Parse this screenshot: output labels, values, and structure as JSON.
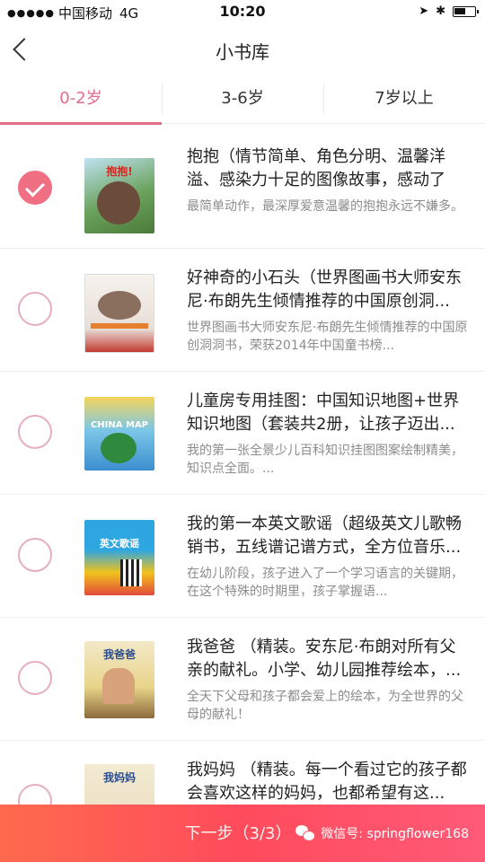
{
  "status_bar": {
    "carrier": "中国移动",
    "network": "4G",
    "time": "10:20"
  },
  "nav": {
    "title": "小书库"
  },
  "tabs": [
    {
      "label": "0-2岁",
      "active": true
    },
    {
      "label": "3-6岁",
      "active": false
    },
    {
      "label": "7岁以上",
      "active": false
    }
  ],
  "books": [
    {
      "title": "抱抱（情节简单、角色分明、温馨洋溢、感染力十足的图像故事，感动了无...",
      "desc": "最简单动作，最深厚爱意温馨的抱抱永远不嫌多。",
      "checked": true,
      "cover_text": "抱抱!"
    },
    {
      "title": "好神奇的小石头（世界图画书大师安东尼·布朗先生倾情推荐的中国原创洞...",
      "desc": "世界图画书大师安东尼·布朗先生倾情推荐的中国原创洞洞书，荣获2014年中国童书榜...",
      "checked": false,
      "cover_text": ""
    },
    {
      "title": "儿童房专用挂图：中国知识地图+世界知识地图（套装共2册，让孩子迈出...",
      "desc": "我的第一张全景少儿百科知识挂图图案绘制精美，知识点全面。...",
      "checked": false,
      "cover_text": "CHINA MAP"
    },
    {
      "title": "我的第一本英文歌谣（超级英文儿歌畅销书，五线谱记谱方式，全方位音乐...",
      "desc": "在幼儿阶段，孩子进入了一个学习语言的关键期，在这个特殊的时期里，孩子掌握语...",
      "checked": false,
      "cover_text": "英文歌谣"
    },
    {
      "title": "我爸爸 （精装。安东尼·布朗对所有父亲的献礼。小学、幼儿园推荐绘本，...",
      "desc": "全天下父母和孩子都会爱上的绘本，为全世界的父母的献礼！",
      "checked": false,
      "cover_text": "我爸爸"
    },
    {
      "title": "我妈妈 （精装。每一个看过它的孩子都会喜欢这样的妈妈，也都希望有这...",
      "desc": "",
      "checked": false,
      "cover_text": "我妈妈"
    }
  ],
  "bottom": {
    "next_label": "下一步（3/3）",
    "watermark": "微信号: springflower168"
  },
  "colors": {
    "accent": "#e36d87",
    "check": "#f06f82",
    "bar_start": "#ff6a4e",
    "bar_end": "#ff5a78"
  }
}
